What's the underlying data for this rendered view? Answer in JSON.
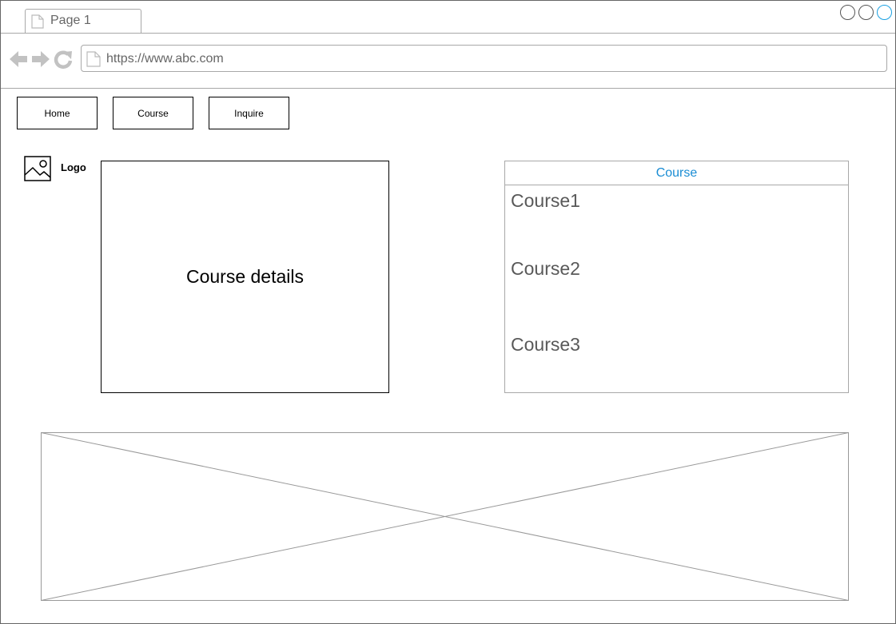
{
  "browser": {
    "tab_label": "Page 1",
    "url": "https://www.abc.com"
  },
  "nav": {
    "home": "Home",
    "course": "Course",
    "inquire": "Inquire"
  },
  "logo": {
    "label": "Logo"
  },
  "details": {
    "title": "Course details"
  },
  "course_list": {
    "header": "Course",
    "items": [
      "Course1",
      "Course2",
      "Course3"
    ]
  },
  "colors": {
    "accent": "#1a8dd4",
    "border": "#a8a8a8",
    "muted_text": "#595959"
  },
  "icons": [
    "document-icon",
    "back-arrow-icon",
    "forward-arrow-icon",
    "reload-icon",
    "image-icon"
  ]
}
